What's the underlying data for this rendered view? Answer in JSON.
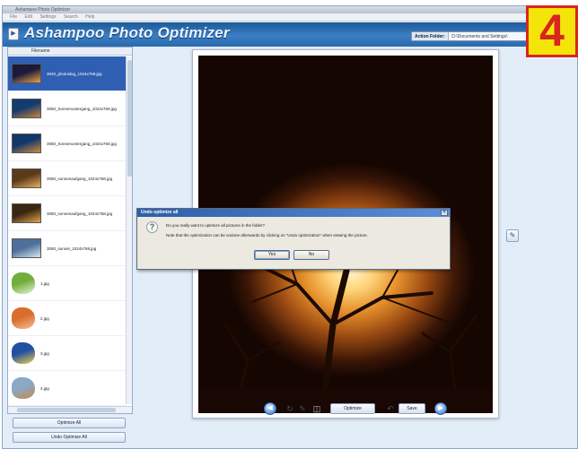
{
  "window": {
    "title": "Ashampoo Photo Optimizer",
    "menu": [
      "File",
      "Edit",
      "Settings",
      "Search",
      "Help"
    ]
  },
  "app": {
    "brand": "Ashampoo Photo Optimizer",
    "action_folder_label": "Action Folder:",
    "action_folder_value": "D:\\Documents and Settings\\"
  },
  "sidebar": {
    "header": "Filename",
    "items": [
      {
        "label": "3040_photoslug_1024x768.jpg",
        "selected": true,
        "colors": [
          "#1b1a3a",
          "#e9a046"
        ]
      },
      {
        "label": "3050_Sonnenuntergang_1024x768.jpg",
        "colors": [
          "#143b6e",
          "#c9843b"
        ]
      },
      {
        "label": "3050_Sonnenuntergang_1024x768.jpg",
        "colors": [
          "#12386b",
          "#cf8a3e"
        ]
      },
      {
        "label": "3050_sonnenaufgang_1024x768.jpg",
        "colors": [
          "#5c3a1a",
          "#e8b05c"
        ]
      },
      {
        "label": "3050_sonnenaufgang_1024x768.jpg",
        "colors": [
          "#3a2712",
          "#e4a34a"
        ]
      },
      {
        "label": "3050_sunset_1024x768.jpg",
        "colors": [
          "#4d6f99",
          "#d8e6f3"
        ]
      },
      {
        "label": "1.jpg",
        "colors": [
          "#6fae3a",
          "#e9f3d8"
        ],
        "small": true
      },
      {
        "label": "2.jpg",
        "colors": [
          "#d96d2c",
          "#f6c19a"
        ],
        "small": true
      },
      {
        "label": "3.jpg",
        "colors": [
          "#2050a0",
          "#f2d24a"
        ],
        "small": true
      },
      {
        "label": "4.jpg",
        "colors": [
          "#8aa8c8",
          "#c58a4a"
        ],
        "small": true
      }
    ],
    "optimize_all": "Optimize All",
    "undo_optimize_all": "Undo Optimize All"
  },
  "dialog": {
    "title": "Undo optimize all",
    "question": "Do you really want to optimize all pictures in the folder?",
    "note": "Note that the optimization can be undone afterwards by clicking on \"Undo optimization\" when viewing the picture.",
    "yes": "Yes",
    "no": "No"
  },
  "toolbar": {
    "optimize": "Optimize",
    "save": "Save"
  },
  "badge": {
    "number": "4"
  },
  "icons": {
    "prev": "arrow-left-icon",
    "next": "arrow-right-icon",
    "rotate": "rotate-icon",
    "edit": "brush-icon",
    "compare": "compare-icon",
    "side_tool": "pen-icon",
    "question": "question-icon"
  }
}
